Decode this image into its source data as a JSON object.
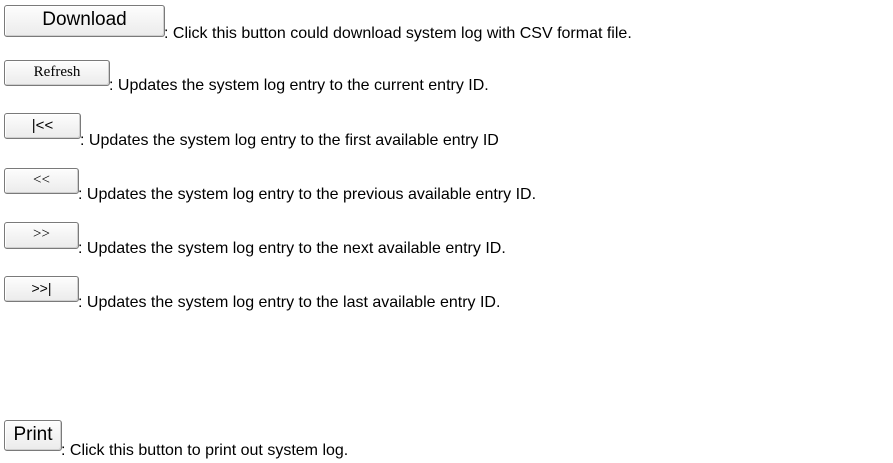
{
  "items": [
    {
      "button": "Download",
      "description": ": Click this button could download system log with CSV format file."
    },
    {
      "button": "Refresh",
      "description": ": Updates the system log entry to the current entry ID."
    },
    {
      "button": "|<<",
      "description": ": Updates the system log entry to the first available entry ID"
    },
    {
      "button": "<<",
      "description": ": Updates the system log entry to the previous available entry ID."
    },
    {
      "button": ">>",
      "description": ": Updates the system log entry to the next available entry ID."
    },
    {
      "button": ">>|",
      "description": ": Updates the system log entry to the last available entry ID."
    },
    {
      "button": "Print",
      "description": ": Click this button to print out system log."
    }
  ]
}
